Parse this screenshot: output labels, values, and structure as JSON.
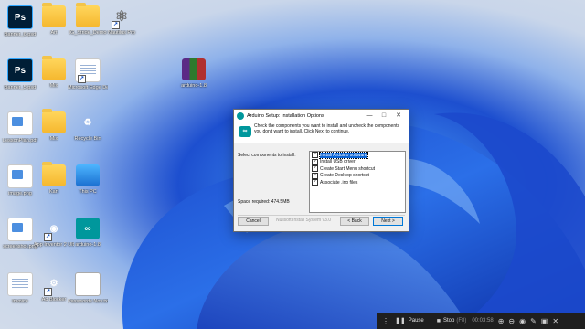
{
  "desktop_icons": [
    {
      "label": "Banner_6.psd",
      "kind": "psd"
    },
    {
      "label": "Art",
      "kind": "folder"
    },
    {
      "label": "IG_Stride_Demo",
      "kind": "folder"
    },
    {
      "label": "Nautilus Pro",
      "kind": "app"
    },
    {
      "label": "Banner_5.psd",
      "kind": "psd"
    },
    {
      "label": "Mix",
      "kind": "folder"
    },
    {
      "label": "Microsoft Edge Dev",
      "kind": "doc"
    },
    {
      "label": "arduino-1.8",
      "kind": "winrar"
    },
    {
      "label": "LessonPlan.pdf",
      "kind": "pngdoc"
    },
    {
      "label": "Mix",
      "kind": "folder"
    },
    {
      "label": "Recycle Bin",
      "kind": "recycle"
    },
    {
      "label": "image.png",
      "kind": "pngdoc"
    },
    {
      "label": "Kart",
      "kind": "folder"
    },
    {
      "label": "This PC",
      "kind": "monitor"
    },
    {
      "label": "screenshot.png",
      "kind": "pngdoc"
    },
    {
      "label": "App Inventor 2 Ultimate",
      "kind": "android"
    },
    {
      "label": "arduino-1.8",
      "kind": "arduino"
    },
    {
      "label": "Invoice",
      "kind": "doc"
    },
    {
      "label": "Ad Blocker",
      "kind": "gear"
    },
    {
      "label": "Passwords Nov.txt",
      "kind": "nvsb"
    }
  ],
  "installer": {
    "title": "Arduino Setup: Installation Options",
    "minimize": "—",
    "maximize": "□",
    "close": "✕",
    "header_text": "Check the components you want to install and uncheck the components you don't want to install. Click Next to continue.",
    "select_label": "Select components to install:",
    "space_required": "Space required: 474.5MB",
    "components": [
      {
        "label": "Install Arduino software",
        "checked": true,
        "selected": true
      },
      {
        "label": "Install USB driver",
        "checked": true
      },
      {
        "label": "Create Start Menu shortcut",
        "checked": true
      },
      {
        "label": "Create Desktop shortcut",
        "checked": true
      },
      {
        "label": "Associate .ino files",
        "checked": true
      }
    ],
    "cancel_label": "Cancel",
    "nullsoft_label": "Nullsoft Install System v3.0",
    "back_label": "< Back",
    "next_label": "Next >"
  },
  "recorder": {
    "pause_label": "Pause",
    "stop_label": "Stop",
    "stop_shortcut": "(F8)",
    "elapsed": "00:03:58"
  },
  "colors": {
    "arduino_teal": "#00979c",
    "selection_blue": "#0a64d6",
    "wallpaper_blue": "#1d4fcf"
  }
}
